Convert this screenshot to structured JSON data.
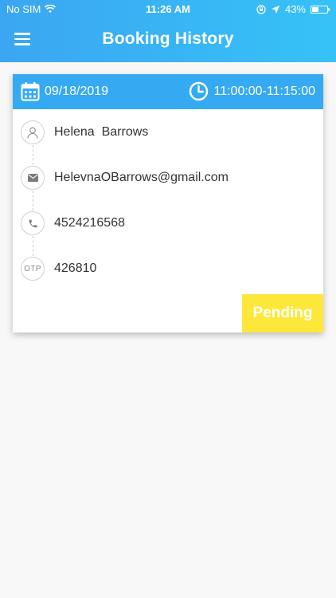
{
  "status_bar": {
    "carrier": "No SIM",
    "time": "11:26 AM",
    "battery": "43%",
    "battery_level": 0.43,
    "icons": [
      "wifi-icon",
      "lock-rotation-icon",
      "location-arrow-icon",
      "battery-icon"
    ]
  },
  "header": {
    "title": "Booking History",
    "menu_icon": "hamburger-menu-icon"
  },
  "booking": {
    "date": "09/18/2019",
    "time_range": "11:00:00-11:15:00",
    "name": "Helena  Barrows",
    "email": "HelevnaOBarrows@gmail.com",
    "phone": "4524216568",
    "otp_label": "OTP",
    "otp": "426810",
    "status": "Pending"
  },
  "colors": {
    "header_start": "#3ba6f2",
    "header_end": "#36c2f7",
    "card_header": "#35aaf2",
    "status_badge": "#fde73a"
  }
}
